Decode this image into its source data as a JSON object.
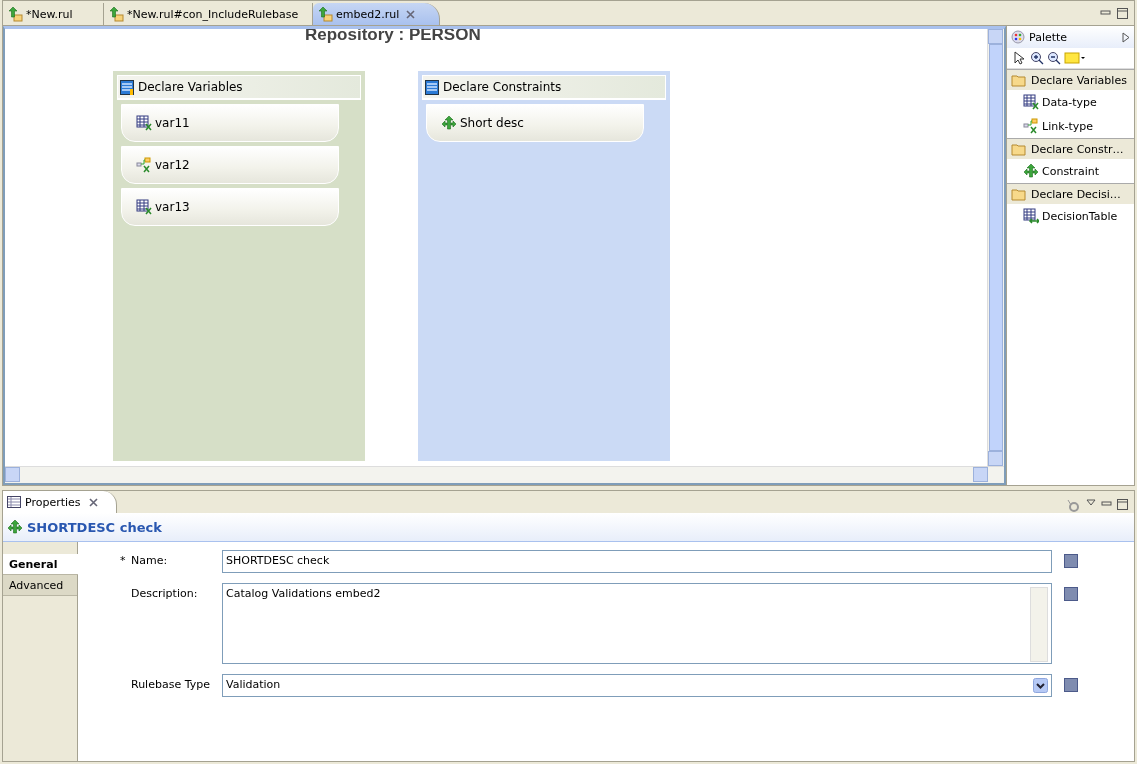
{
  "editor_tabs": [
    {
      "label": "*New.rul",
      "selected": false
    },
    {
      "label": "*New.rul#con_IncludeRulebase",
      "selected": false
    },
    {
      "label": "embed2.rul",
      "selected": true
    }
  ],
  "canvas": {
    "title": "Repository : PERSON",
    "containers": [
      {
        "title": "Declare Variables",
        "kind": "variables",
        "items": [
          {
            "label": "var11",
            "kind": "data"
          },
          {
            "label": "var12",
            "kind": "link"
          },
          {
            "label": "var13",
            "kind": "data"
          }
        ]
      },
      {
        "title": "Declare Constraints",
        "kind": "constraints",
        "items": [
          {
            "label": "Short desc",
            "kind": "constraint"
          }
        ]
      }
    ]
  },
  "palette": {
    "title": "Palette",
    "drawers": [
      {
        "label": "Declare Variables",
        "items": [
          {
            "label": "Data-type",
            "kind": "data"
          },
          {
            "label": "Link-type",
            "kind": "link"
          }
        ]
      },
      {
        "label": "Declare Constr…",
        "items": [
          {
            "label": "Constraint",
            "kind": "constraint"
          }
        ]
      },
      {
        "label": "Declare Decisi…",
        "items": [
          {
            "label": "DecisionTable",
            "kind": "table"
          }
        ]
      }
    ]
  },
  "properties": {
    "tab": "Properties",
    "header": "SHORTDESC check",
    "side_tabs": [
      {
        "label": "General",
        "selected": true
      },
      {
        "label": "Advanced",
        "selected": false
      }
    ],
    "fields": [
      {
        "label": "Name:",
        "required_mark": "*",
        "kind": "text",
        "value": "SHORTDESC check"
      },
      {
        "label": "Description:",
        "kind": "textarea",
        "value": "Catalog Validations embed2"
      },
      {
        "label": "Rulebase Type",
        "kind": "select",
        "value": "Validation"
      }
    ]
  }
}
